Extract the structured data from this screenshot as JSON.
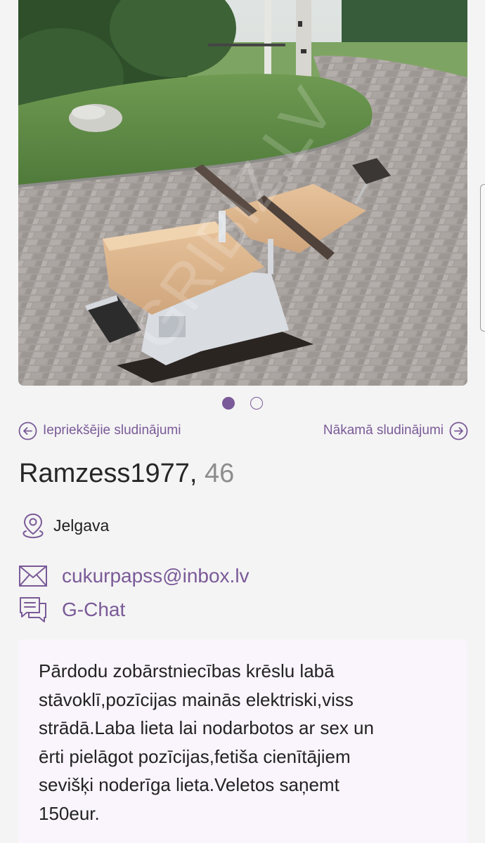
{
  "photo": {
    "alt": "Dentist chair on paved path",
    "watermark": "GRIBIZ.LV"
  },
  "gallery": {
    "dot_count": 2,
    "active_index": 0
  },
  "nav": {
    "prev_label": "Iepriekšējie sludinājumi",
    "next_label": "Nākamā sludinājumi"
  },
  "profile": {
    "name": "Ramzess1977,",
    "age": "46",
    "location": "Jelgava",
    "email": "cukurpapss@inbox.lv",
    "chat_label": "G-Chat"
  },
  "description": {
    "lines": [
      "Pārdodu zobārstniecības krēslu labā",
      "stāvoklī,pozīcijas mainās elektriski,viss",
      "strādā.Laba lieta lai nodarbotos ar sex un",
      "ērti pielāgot pozīcijas,fetiša cienītājiem",
      "sevišķi noderīga lieta.Veletos saņemt",
      "150eur."
    ]
  },
  "colors": {
    "accent": "#7a5a98",
    "background": "#f4f4f4",
    "description_bg": "#faf4fc"
  },
  "icons": {
    "prev": "arrow-left-circle-icon",
    "next": "arrow-right-circle-icon",
    "location": "map-pin-icon",
    "email": "envelope-icon",
    "chat": "chat-bubbles-icon"
  }
}
